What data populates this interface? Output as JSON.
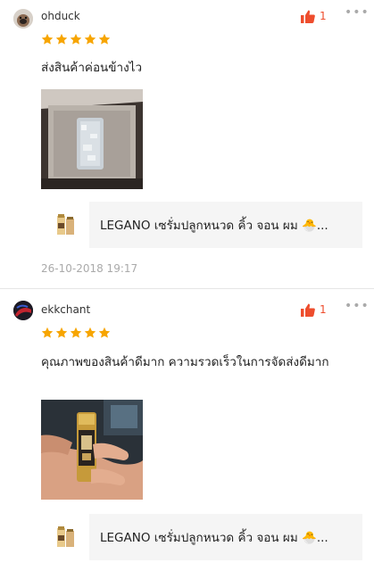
{
  "reviews": [
    {
      "username": "ohduck",
      "like_count": "1",
      "rating": 5,
      "comment": "ส่งสินค้าค่อนข้างไว",
      "product": {
        "name": "LEGANO เซรั่มปลูกหนวด คิ้ว จอน ผม 🐣..."
      },
      "date": "26-10-2018 19:17"
    },
    {
      "username": "ekkchant",
      "like_count": "1",
      "rating": 5,
      "comment": " คุณภาพของสินค้าดีมาก ความรวดเร็วในการจัดส่งดีมาก",
      "product": {
        "name": "LEGANO เซรั่มปลูกหนวด คิ้ว จอน ผม 🐣..."
      }
    }
  ],
  "icons": {
    "like": "thumbs-up-icon",
    "more": "more-options-icon",
    "star": "star-icon"
  },
  "colors": {
    "accent": "#ee4d2d",
    "star": "#f7a500",
    "muted": "#aaaaaa",
    "card_bg": "#f5f5f5"
  }
}
